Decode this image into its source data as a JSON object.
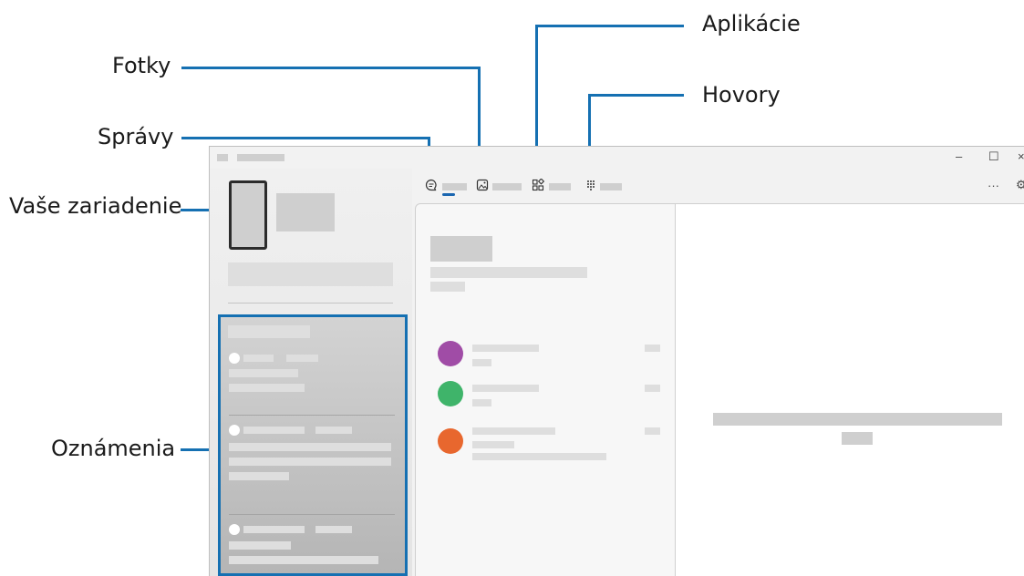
{
  "callouts": {
    "aplikacie": "Aplikácie",
    "fotky": "Fotky",
    "hovory": "Hovory",
    "spravy": "Správy",
    "vase_zariadenie": "Vaše zariadenie",
    "oznamenia": "Oznámenia"
  },
  "window": {
    "controls": {
      "minimize": "–",
      "maximize": "☐",
      "close": "×",
      "more": "···",
      "settings": "⚙"
    },
    "tabs": [
      {
        "icon": "message-icon"
      },
      {
        "icon": "photo-icon"
      },
      {
        "icon": "apps-icon"
      },
      {
        "icon": "dialpad-icon"
      }
    ]
  },
  "conversations": [
    {
      "avatar_color": "#a04ca6"
    },
    {
      "avatar_color": "#3fb46a"
    },
    {
      "avatar_color": "#e8672e"
    }
  ],
  "colors": {
    "callout_line": "#1570b2",
    "notification_border": "#1570b2"
  }
}
